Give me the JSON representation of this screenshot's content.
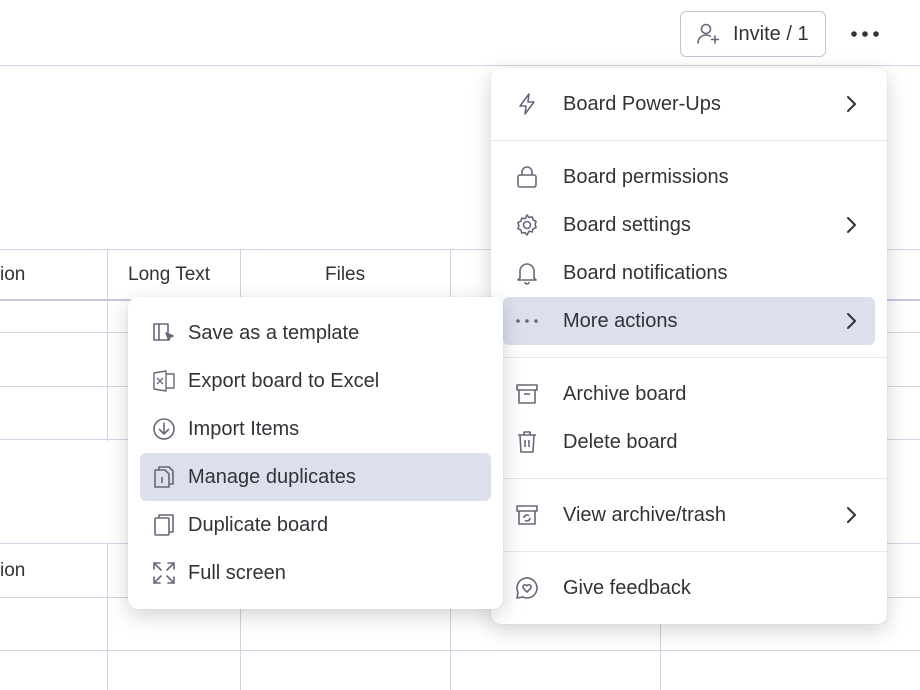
{
  "header": {
    "invite_label": "Invite / 1",
    "more_icon": "ellipsis-icon"
  },
  "table": {
    "columns_top": [
      "ion",
      "Long Text",
      "Files"
    ],
    "columns_bottom": [
      "ion"
    ]
  },
  "board_menu": {
    "items": [
      {
        "label": "Board Power-Ups",
        "icon": "lightning-icon",
        "has_submenu": true
      },
      {
        "label": "Board permissions",
        "icon": "lock-icon",
        "has_submenu": false
      },
      {
        "label": "Board settings",
        "icon": "gear-icon",
        "has_submenu": true
      },
      {
        "label": "Board notifications",
        "icon": "bell-icon",
        "has_submenu": false
      },
      {
        "label": "More actions",
        "icon": "dots-icon",
        "has_submenu": true,
        "active": true
      },
      {
        "label": "Archive board",
        "icon": "archive-icon",
        "has_submenu": false
      },
      {
        "label": "Delete board",
        "icon": "trash-icon",
        "has_submenu": false
      },
      {
        "label": "View archive/trash",
        "icon": "archive-restore-icon",
        "has_submenu": true
      },
      {
        "label": "Give feedback",
        "icon": "heart-bubble-icon",
        "has_submenu": false
      }
    ]
  },
  "more_actions_menu": {
    "items": [
      {
        "label": "Save as a template",
        "icon": "template-icon"
      },
      {
        "label": "Export board to Excel",
        "icon": "excel-icon"
      },
      {
        "label": "Import Items",
        "icon": "download-circle-icon"
      },
      {
        "label": "Manage duplicates",
        "icon": "duplicates-icon",
        "active": true
      },
      {
        "label": "Duplicate board",
        "icon": "copy-icon"
      },
      {
        "label": "Full screen",
        "icon": "fullscreen-icon"
      }
    ]
  },
  "colors": {
    "active_background": "#dcdfec",
    "grid_line": "#d0d4e4",
    "text": "#323338",
    "icon": "#676879"
  }
}
